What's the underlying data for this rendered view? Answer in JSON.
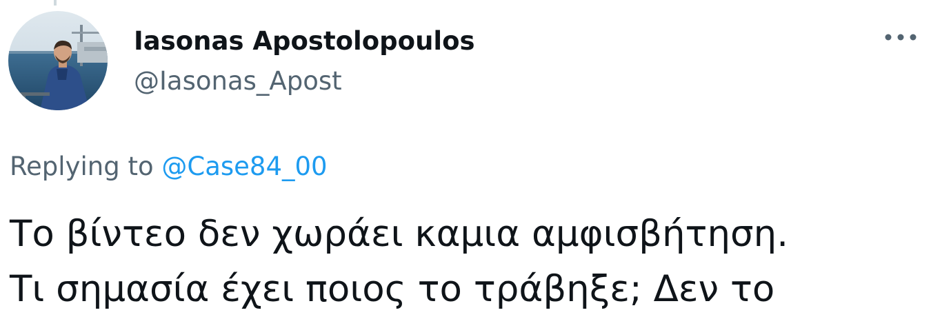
{
  "author": {
    "display_name": "Iasonas Apostolopoulos",
    "handle": "@Iasonas_Apost",
    "avatar_icon": "profile-photo"
  },
  "menu": {
    "more_icon": "more-horizontal-icon"
  },
  "reply": {
    "prefix": "Replying to ",
    "mention": "@Case84_00"
  },
  "tweet": {
    "lines": [
      "Το βίντεο δεν χωράει καμια αμφισβήτηση.",
      "Τι σημασία έχει ποιος το τράβηξε; Δεν το"
    ]
  },
  "colors": {
    "text": "#0f1419",
    "secondary": "#536471",
    "link": "#1d9bf0"
  }
}
